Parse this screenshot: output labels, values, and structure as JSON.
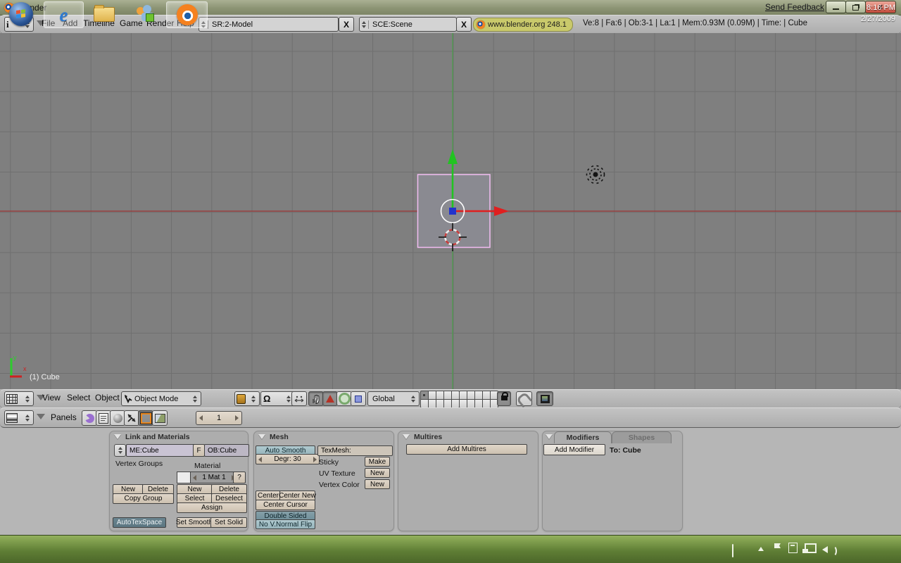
{
  "window": {
    "title": "Blender",
    "send_feedback": "Send Feedback"
  },
  "icons": {
    "info": "i",
    "close_x": "X",
    "window_close": "x",
    "pivot": "Ω",
    "ie_e": "e"
  },
  "header": {
    "menus": [
      "File",
      "Add",
      "Timeline",
      "Game",
      "Render",
      "Help"
    ],
    "screen": "SR:2-Model",
    "scene": "SCE:Scene",
    "version": "www.blender.org 248.1",
    "stats": "Ve:8 | Fa:6 | Ob:3-1 | La:1 | Mem:0.93M (0.09M) | Time: | Cube"
  },
  "viewport": {
    "label": "(1) Cube",
    "axis_x": "x",
    "axis_y": "y"
  },
  "vheader": {
    "menus": [
      "View",
      "Select",
      "Object"
    ],
    "mode": "Object Mode",
    "orientation": "Global"
  },
  "bheader": {
    "panels_label": "Panels",
    "frame": "1"
  },
  "link_panel": {
    "title": "Link and Materials",
    "me": "ME:Cube",
    "f": "F",
    "ob": "OB:Cube",
    "vertex_groups_label": "Vertex Groups",
    "material_label": "Material",
    "mat_count": "1 Mat 1",
    "help": "?",
    "vg_new": "New",
    "vg_delete": "Delete",
    "copy_group": "Copy Group",
    "mat_new": "New",
    "mat_delete": "Delete",
    "select": "Select",
    "deselect": "Deselect",
    "assign": "Assign",
    "autotex_space": "AutoTexSpace",
    "set_smooth": "Set Smooth",
    "set_solid": "Set Solid"
  },
  "mesh_panel": {
    "title": "Mesh",
    "auto_smooth": "Auto Smooth",
    "degr": "Degr: 30",
    "texmesh": "TexMesh:",
    "sticky_label": "Sticky",
    "make": "Make",
    "uv_texture_label": "UV Texture",
    "uv_new": "New",
    "vertex_color_label": "Vertex Color",
    "vc_new": "New",
    "center": "Center",
    "center_new": "Center New",
    "center_cursor": "Center Cursor",
    "double_sided": "Double Sided",
    "no_vnormal_flip": "No V.Normal Flip"
  },
  "multires_panel": {
    "title": "Multires",
    "add_button": "Add Multires"
  },
  "modifiers_panel": {
    "tab_modifiers": "Modifiers",
    "tab_shapes": "Shapes",
    "add_button": "Add Modifier",
    "target": "To: Cube"
  },
  "taskbar": {
    "time": "8:16 PM",
    "date": "2/27/2009"
  },
  "colors": {
    "selected_outline": "#f2bdf2",
    "axis_x_red": "#9e3434",
    "axis_y_green": "#4aa04a",
    "version_badge": "#c9c96b",
    "viewport_bg": "#7f7f7f"
  }
}
